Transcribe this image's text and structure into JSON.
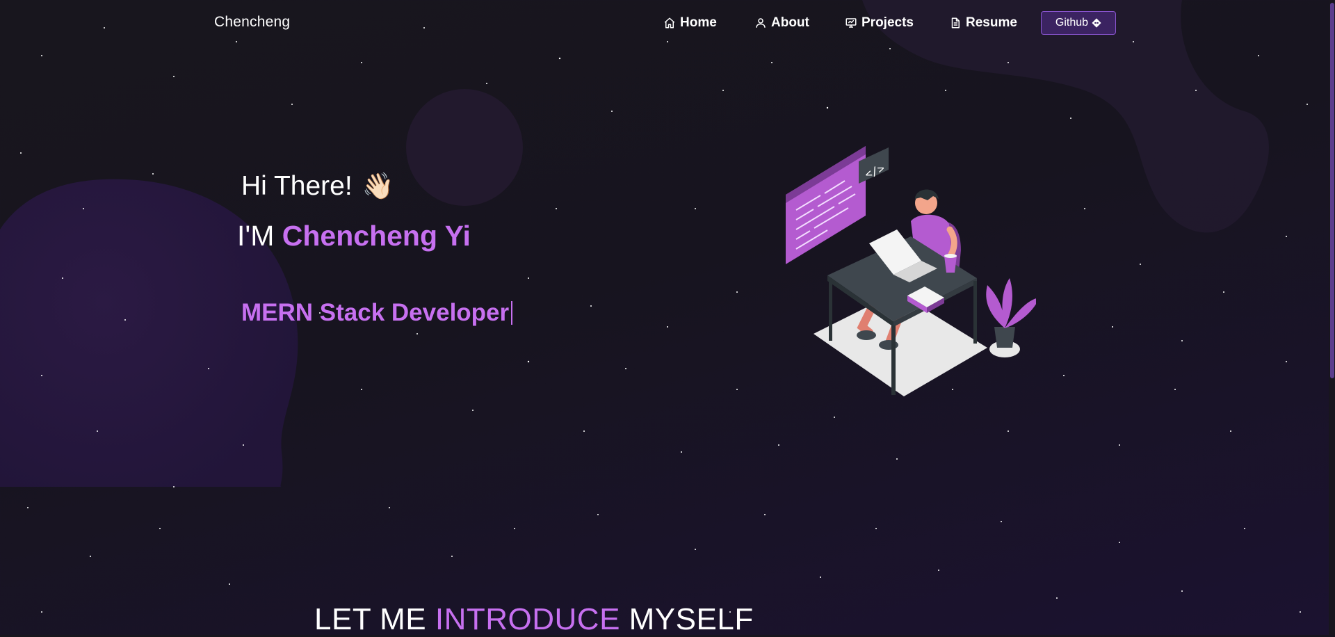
{
  "nav": {
    "brand": "Chencheng",
    "items": [
      {
        "label": "Home",
        "icon": "home-icon"
      },
      {
        "label": "About",
        "icon": "user-icon"
      },
      {
        "label": "Projects",
        "icon": "projects-icon"
      },
      {
        "label": "Resume",
        "icon": "document-icon"
      }
    ],
    "github_label": "Github"
  },
  "hero": {
    "greeting": "Hi There!",
    "wave_emoji": "👋🏻",
    "im_prefix": "I'M",
    "name": "Chencheng Yi",
    "role": "MERN Stack Developer"
  },
  "intro": {
    "part1": "LET ME",
    "part2": "INTRODUCE",
    "part3": "MYSELF"
  },
  "colors": {
    "accent": "#c770f0",
    "background": "#17141f",
    "button_bg": "#3b2361"
  }
}
